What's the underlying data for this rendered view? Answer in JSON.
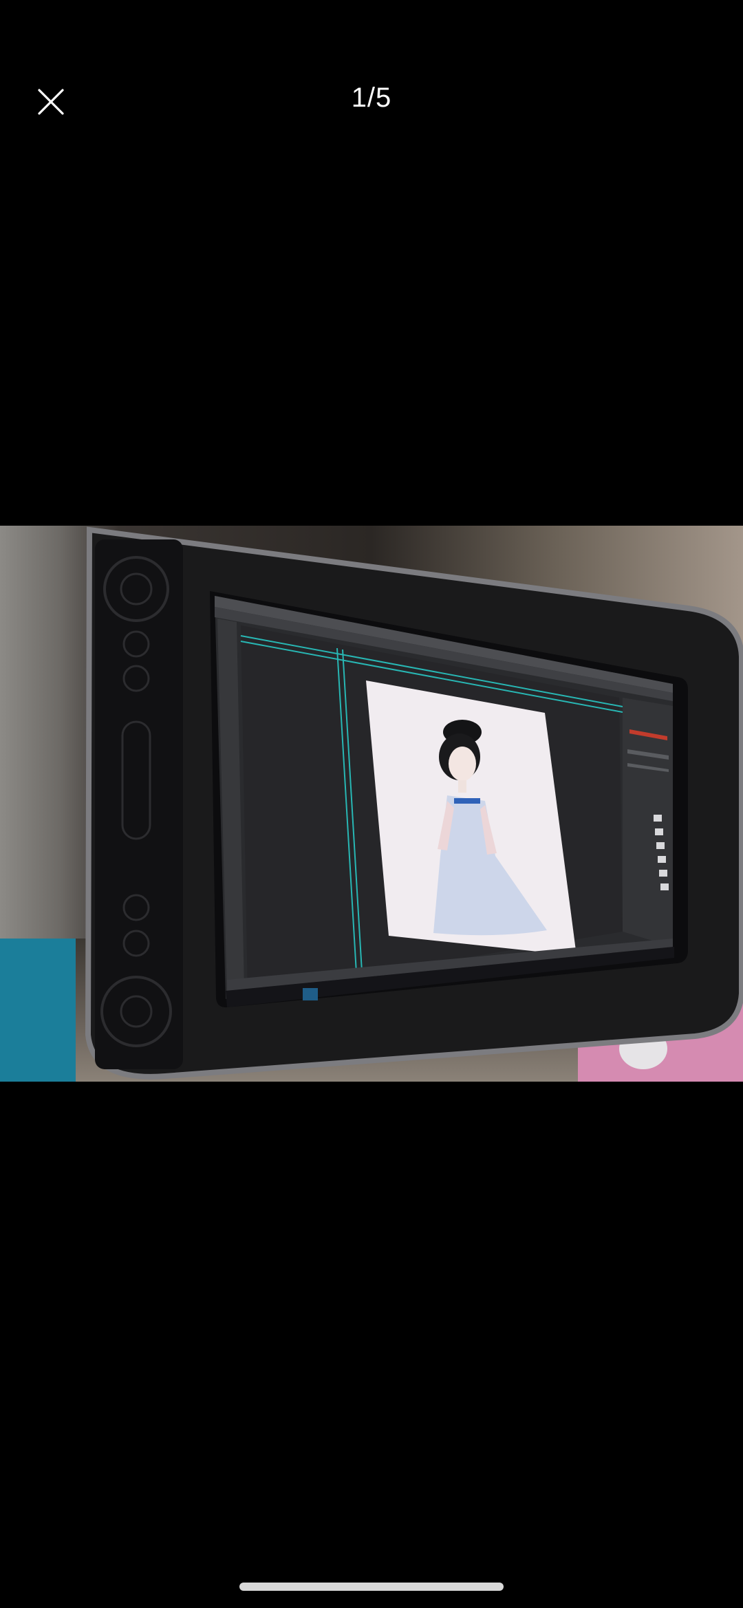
{
  "viewer": {
    "counter": "1/5",
    "close_icon": "close-icon"
  },
  "photo": {
    "description_icon": "photo-of-drawing-tablet"
  }
}
